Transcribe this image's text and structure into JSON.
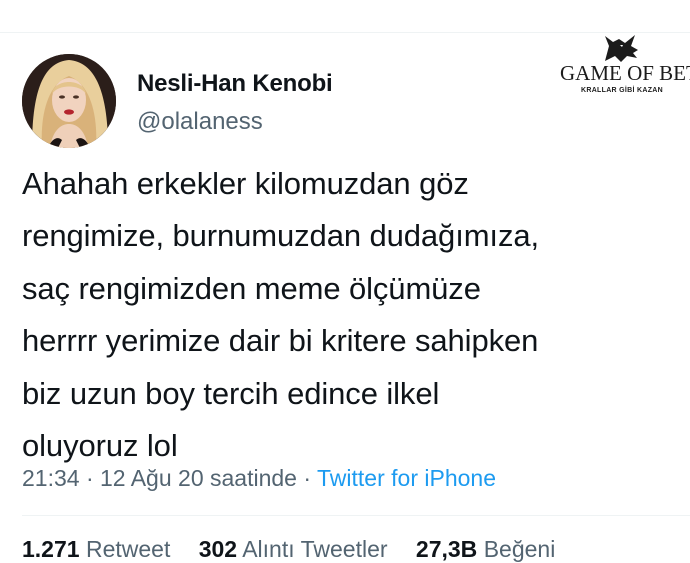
{
  "profile": {
    "display_name": "Nesli-Han Kenobi",
    "handle": "@olalaness"
  },
  "watermark": {
    "title": "GAME OF BET",
    "subtitle": "KRALLAR GİBİ KAZAN"
  },
  "tweet": {
    "lines": [
      "Ahahah erkekler kilomuzdan göz",
      "rengimize, burnumuzdan dudağımıza,",
      "saç rengimizden meme ölçümüze",
      "herrrr yerimize dair bi kritere sahipken",
      "biz uzun boy tercih edince ilkel",
      "oluyoruz lol"
    ]
  },
  "meta": {
    "time": "21:34",
    "separator": "·",
    "date": "12 Ağu 20 saatinde",
    "source": "Twitter for iPhone"
  },
  "stats": {
    "retweets_count": "1.271",
    "retweets_label": "Retweet",
    "quotes_count": "302",
    "quotes_label": "Alıntı Tweetler",
    "likes_count": "27,3B",
    "likes_label": "Beğeni"
  },
  "colors": {
    "link": "#1d9bf0",
    "secondary_text": "#536471",
    "primary_text": "#0f1419"
  }
}
